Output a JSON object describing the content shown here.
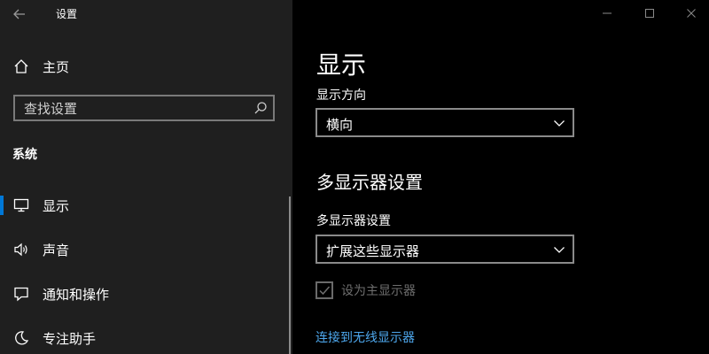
{
  "window": {
    "title": "设置",
    "controls": {
      "minimize": "minimize-icon",
      "maximize": "maximize-icon",
      "close": "close-icon"
    }
  },
  "sidebar": {
    "home_label": "主页",
    "search": {
      "placeholder": "查找设置"
    },
    "section_label": "系统",
    "items": [
      {
        "label": "显示",
        "icon": "monitor-icon",
        "active": true
      },
      {
        "label": "声音",
        "icon": "speaker-icon",
        "active": false
      },
      {
        "label": "通知和操作",
        "icon": "notification-icon",
        "active": false
      },
      {
        "label": "专注助手",
        "icon": "moon-icon",
        "active": false
      }
    ]
  },
  "main": {
    "title": "显示",
    "orientation": {
      "label": "显示方向",
      "value": "横向"
    },
    "multi_display": {
      "section_title": "多显示器设置",
      "label": "多显示器设置",
      "value": "扩展这些显示器",
      "primary_checkbox": {
        "label": "设为主显示器",
        "checked": true,
        "disabled": true
      },
      "wireless_link": "连接到无线显示器"
    }
  },
  "colors": {
    "accent": "#0078d7",
    "link": "#4ea8ee",
    "sidebar_bg": "#1f1f1f",
    "main_bg": "#000000",
    "disabled_text": "#6e6e6e"
  }
}
